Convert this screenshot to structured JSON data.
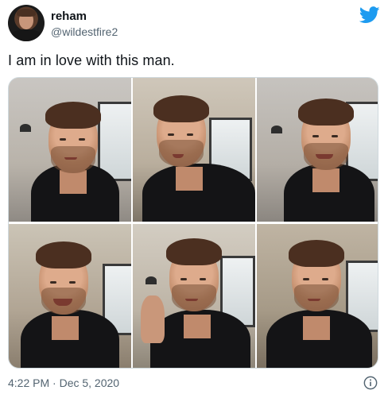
{
  "tweet": {
    "display_name": "reham",
    "handle": "@wildestfire2",
    "text": "I am in love with this man.",
    "timestamp": "4:22 PM · Dec 5, 2020",
    "images_alt": [
      "photo-1",
      "photo-2",
      "photo-3",
      "photo-4",
      "photo-5",
      "photo-6"
    ]
  },
  "icons": {
    "brand": "twitter-bird-icon",
    "info": "info-icon"
  },
  "colors": {
    "twitter_blue": "#1d9bf0",
    "secondary_text": "#536471",
    "primary_text": "#0f1419"
  }
}
